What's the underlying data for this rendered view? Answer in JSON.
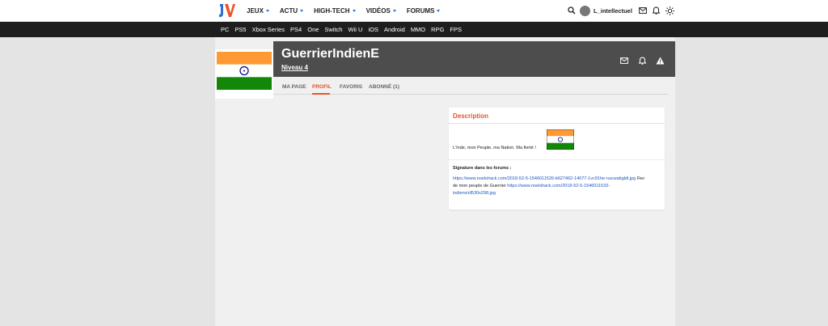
{
  "nav": {
    "logo_text": "JV",
    "items": [
      {
        "label": "JEUX"
      },
      {
        "label": "ACTU"
      },
      {
        "label": "HIGH-TECH"
      },
      {
        "label": "VIDÉOS"
      },
      {
        "label": "FORUMS"
      }
    ],
    "username": "L_intellectuel",
    "icons": [
      "search-icon",
      "avatar",
      "mail-icon",
      "bell-icon",
      "theme-sun-icon"
    ]
  },
  "platforms": [
    "PC",
    "PS5",
    "Xbox Series",
    "PS4",
    "One",
    "Switch",
    "Wii U",
    "iOS",
    "Android",
    "MMO",
    "RPG",
    "FPS"
  ],
  "profile": {
    "name": "GuerrierIndienE",
    "level": "Niveau 4",
    "header_icons": [
      "mail-icon",
      "bell-icon",
      "warning-icon"
    ]
  },
  "tabs": [
    {
      "label": "MA PAGE",
      "active": false
    },
    {
      "label": "PROFIL",
      "active": true
    },
    {
      "label": "FAVORIS",
      "active": false
    },
    {
      "label": "ABONNÉ (1)",
      "active": false
    }
  ],
  "description": {
    "title": "Description",
    "text": "L'Inde, mon Peuple, ma Nation. Ma fierté !",
    "signature_label": "Signature dans les forums :",
    "signature_link1": "https://www.noelshack.com/2018-52-5-1546011526-b627462-14077-1vc91he-nucwabgldi.jpg",
    "signature_text": " Fier de mon peuple de Guerrier ",
    "signature_link2": "https://www.noelshack.com/2018-52-5-1546011533-indienviril530x298.jpg"
  },
  "colors": {
    "accent": "#e8552a",
    "link": "#1a55c4",
    "flag_saffron": "#ff9933",
    "flag_green": "#138808",
    "flag_chakra": "#000080"
  }
}
